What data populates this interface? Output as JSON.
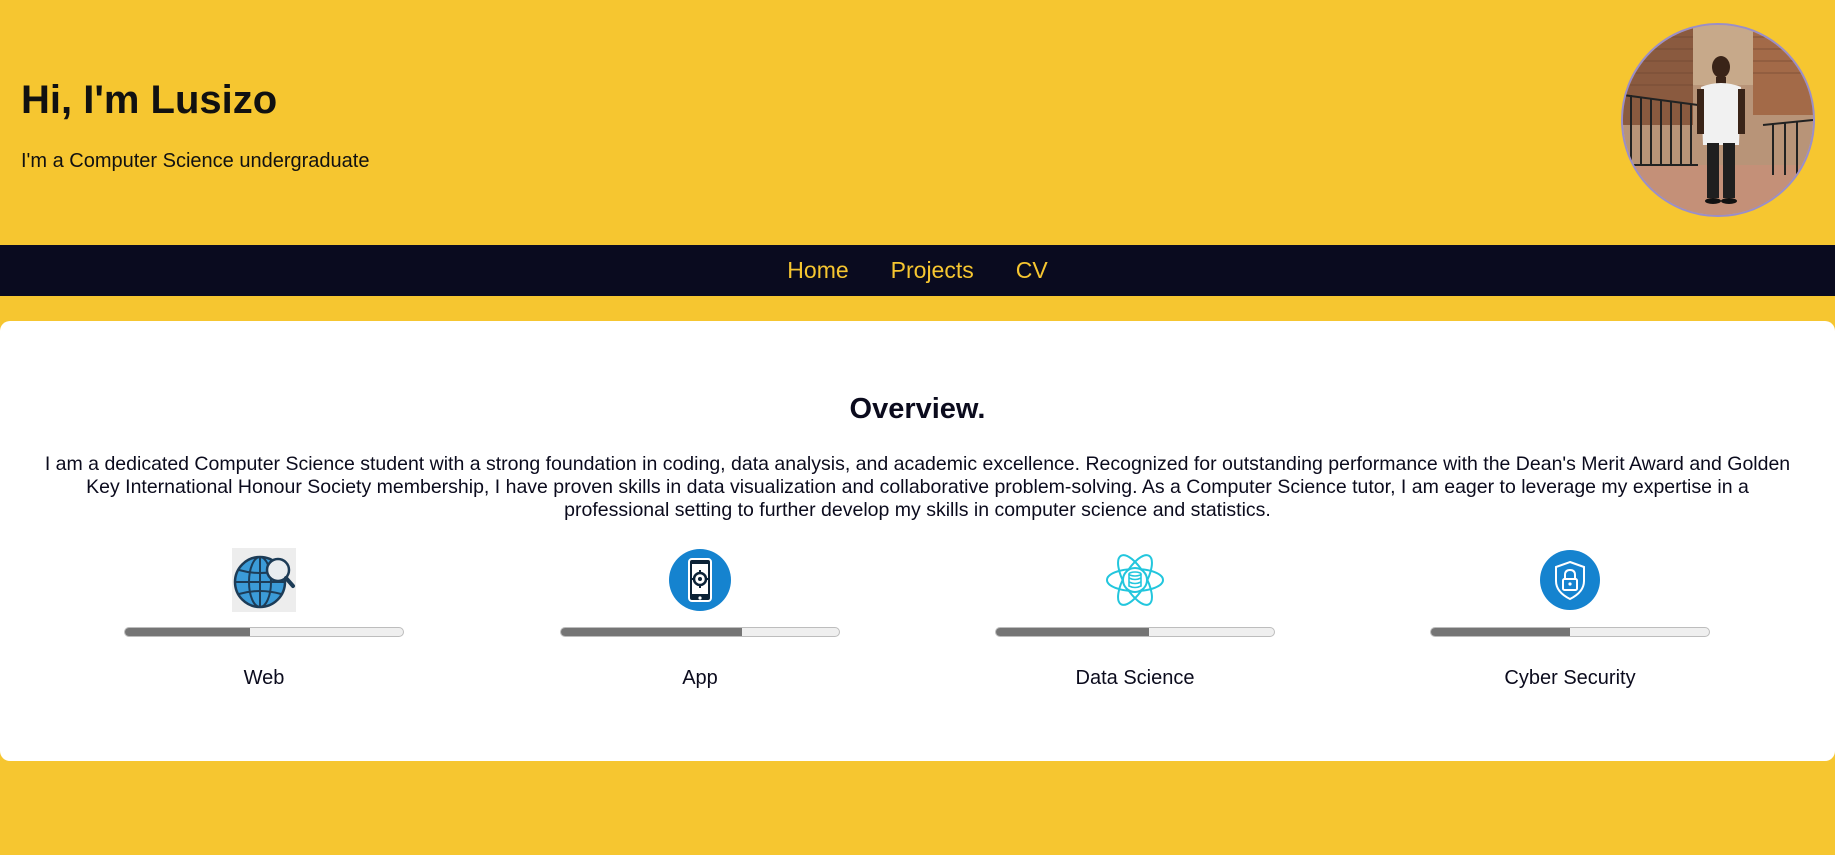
{
  "header": {
    "title": "Hi, I'm Lusizo",
    "subtitle": "I'm a Computer Science undergraduate"
  },
  "nav": {
    "items": [
      {
        "label": "Home"
      },
      {
        "label": "Projects"
      },
      {
        "label": "CV"
      }
    ]
  },
  "overview": {
    "title": "Overview.",
    "text": "I am a dedicated Computer Science student with a strong foundation in coding, data analysis, and academic excellence. Recognized for outstanding performance with the Dean's Merit Award and Golden Key International Honour Society membership, I have proven skills in data visualization and collaborative problem-solving. As a Computer Science tutor, I am eager to leverage my expertise in a professional setting to further develop my skills in computer science and statistics."
  },
  "skills": [
    {
      "label": "Web",
      "icon": "globe-search-icon",
      "progress": 0.45
    },
    {
      "label": "App",
      "icon": "mobile-app-icon",
      "progress": 0.65
    },
    {
      "label": "Data Science",
      "icon": "atom-database-icon",
      "progress": 0.55
    },
    {
      "label": "Cyber Security",
      "icon": "shield-lock-icon",
      "progress": 0.5
    }
  ],
  "colors": {
    "background": "#f6c630",
    "nav_background": "#0a0b1f",
    "nav_text": "#f6c630",
    "card_background": "#ffffff",
    "progress_fill": "#757575",
    "icon_blue": "#1583cf",
    "icon_cyan": "#22c6dd"
  }
}
